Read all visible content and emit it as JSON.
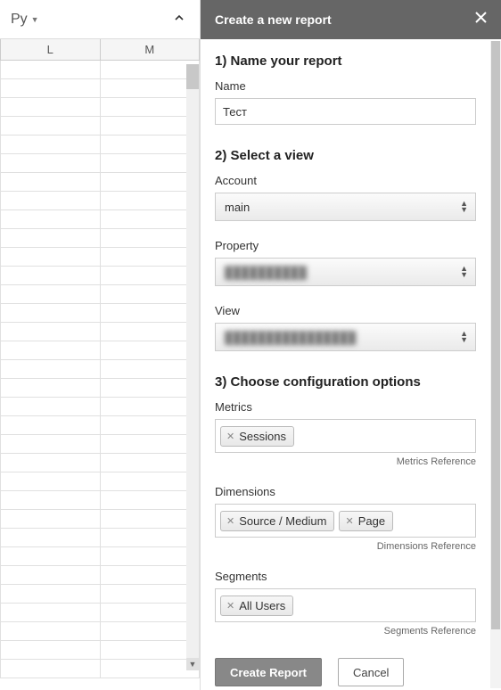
{
  "sheet": {
    "toolbar_label": "Py",
    "columns": [
      "L",
      "M"
    ]
  },
  "panel": {
    "title": "Create a new report",
    "section1": {
      "title": "1) Name your report",
      "name_label": "Name",
      "name_value": "Тест"
    },
    "section2": {
      "title": "2) Select a view",
      "account_label": "Account",
      "account_value": "main",
      "property_label": "Property",
      "property_value": "██████████",
      "view_label": "View",
      "view_value": "████████████████"
    },
    "section3": {
      "title": "3) Choose configuration options",
      "metrics_label": "Metrics",
      "metrics_tags": [
        "Sessions"
      ],
      "metrics_ref": "Metrics Reference",
      "dimensions_label": "Dimensions",
      "dimensions_tags": [
        "Source / Medium",
        "Page"
      ],
      "dimensions_ref": "Dimensions Reference",
      "segments_label": "Segments",
      "segments_tags": [
        "All Users"
      ],
      "segments_ref": "Segments Reference"
    },
    "buttons": {
      "create": "Create Report",
      "cancel": "Cancel"
    }
  }
}
